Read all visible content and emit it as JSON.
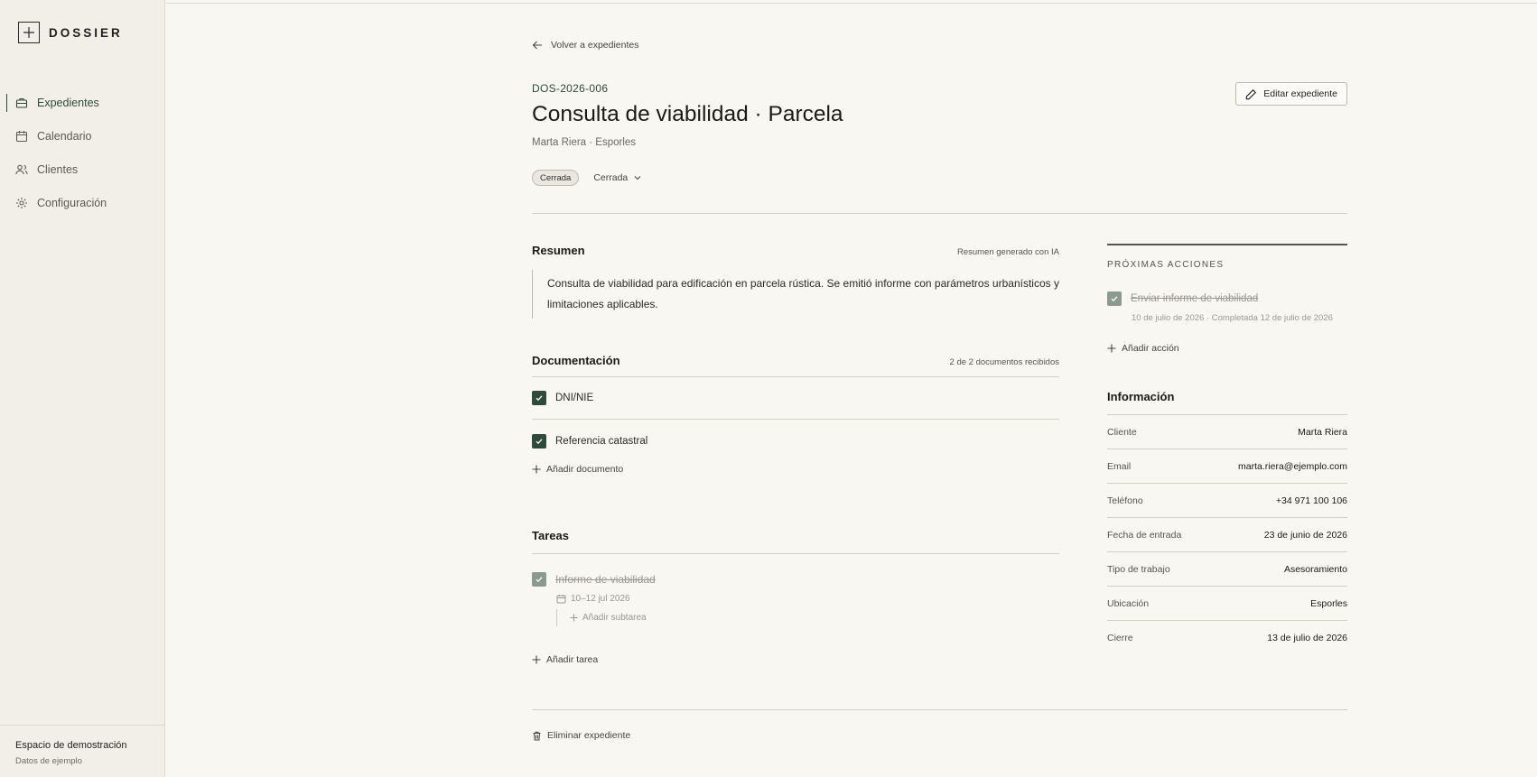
{
  "brand": {
    "name": "DOSSIER",
    "logo_icon": "plus-icon"
  },
  "nav": {
    "items": [
      {
        "label": "Expedientes",
        "icon": "briefcase-icon",
        "active": true
      },
      {
        "label": "Calendario",
        "icon": "calendar-icon"
      },
      {
        "label": "Clientes",
        "icon": "users-icon"
      },
      {
        "label": "Configuración",
        "icon": "gear-icon"
      }
    ]
  },
  "workspace": {
    "name": "Espacio de demostración",
    "subtitle": "Datos de ejemplo"
  },
  "header": {
    "back_label": "Volver a expedientes",
    "case_id": "DOS-2026-006",
    "title": "Consulta de viabilidad · Parcela",
    "subtitle": "Marta Riera · Esporles",
    "status_badge": "Cerrada",
    "status_select": "Cerrada",
    "edit_label": "Editar expediente"
  },
  "summary": {
    "title": "Resumen",
    "meta": "Resumen generado con IA",
    "text": "Consulta de viabilidad para edificación en parcela rústica. Se emitió informe con parámetros urbanísticos y limitaciones aplicables."
  },
  "docs": {
    "title": "Documentación",
    "meta": "2 de 2 documentos recibidos",
    "items": [
      {
        "label": "DNI/NIE"
      },
      {
        "label": "Referencia catastral"
      }
    ],
    "add_label": "Añadir documento"
  },
  "tasks": {
    "title": "Tareas",
    "items": [
      {
        "label": "Informe de viabilidad",
        "date": "10–12 jul 2026"
      }
    ],
    "add_subtask_label": "Añadir subtarea",
    "add_label": "Añadir tarea"
  },
  "actions": {
    "title": "PRÓXIMAS ACCIONES",
    "items": [
      {
        "label": "Enviar informe de viabilidad",
        "meta": "10 de julio de 2026 · Completada 12 de julio de 2026"
      }
    ],
    "add_label": "Añadir acción"
  },
  "info": {
    "title": "Información",
    "rows": [
      {
        "label": "Cliente",
        "value": "Marta Riera"
      },
      {
        "label": "Email",
        "value": "marta.riera@ejemplo.com"
      },
      {
        "label": "Teléfono",
        "value": "+34 971 100 106"
      },
      {
        "label": "Fecha de entrada",
        "value": "23 de junio de 2026"
      },
      {
        "label": "Tipo de trabajo",
        "value": "Asesoramiento"
      },
      {
        "label": "Ubicación",
        "value": "Esporles"
      },
      {
        "label": "Cierre",
        "value": "13 de julio de 2026"
      }
    ]
  },
  "delete_label": "Eliminar expediente",
  "colors": {
    "accent": "#2e4a38",
    "background": "#f8f7f2",
    "sidebar": "#f1efe7",
    "muted_check": "#8c998f"
  }
}
